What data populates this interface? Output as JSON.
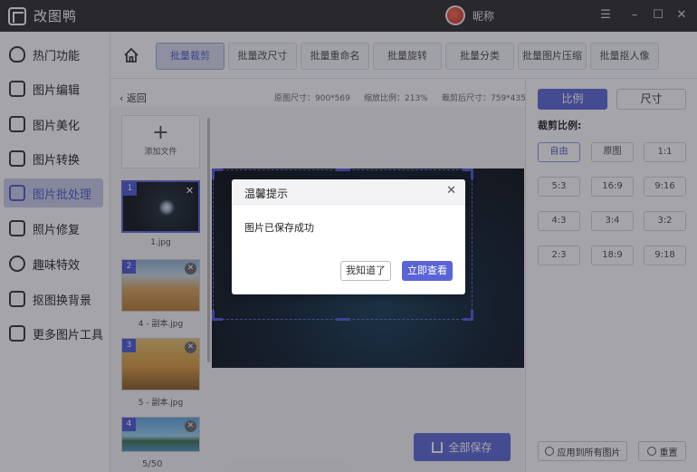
{
  "app": {
    "title": "改图鸭",
    "nickname": "昵称"
  },
  "window_controls": [
    "☰",
    "–",
    "☐",
    "✕"
  ],
  "sidebar": {
    "items": [
      {
        "label": "热门功能",
        "icon": "fire-icon"
      },
      {
        "label": "图片编辑",
        "icon": "image-edit-icon"
      },
      {
        "label": "图片美化",
        "icon": "beautify-icon"
      },
      {
        "label": "图片转换",
        "icon": "convert-icon"
      },
      {
        "label": "图片批处理",
        "icon": "batch-icon",
        "active": true
      },
      {
        "label": "照片修复",
        "icon": "repair-icon"
      },
      {
        "label": "趣味特效",
        "icon": "effects-icon"
      },
      {
        "label": "抠图换背景",
        "icon": "cutout-icon"
      },
      {
        "label": "更多图片工具",
        "icon": "toolbox-icon"
      }
    ]
  },
  "tabs": {
    "items": [
      "批量裁剪",
      "批量改尺寸",
      "批量重命名",
      "批量旋转",
      "批量分类",
      "批量图片压缩",
      "批量抠人像"
    ],
    "active_index": 0
  },
  "content": {
    "back_label": "返回",
    "original_size": "原图尺寸：900*569",
    "zoom_ratio": "缩放比例：213%",
    "cropped_size": "裁剪后尺寸：759*435"
  },
  "thumbnails": {
    "add_label": "添加文件",
    "items": [
      {
        "num": "1",
        "name": "1.jpg",
        "selected": true
      },
      {
        "num": "2",
        "name": "4 - 副本.jpg"
      },
      {
        "num": "3",
        "name": "5 - 副本.jpg"
      },
      {
        "num": "4",
        "name": ""
      }
    ],
    "page_count": "5/50"
  },
  "save_all_label": "全部保存",
  "right_panel": {
    "mode_tabs": [
      "比例",
      "尺寸"
    ],
    "crop_ratio_label": "裁剪比例:",
    "ratios": [
      "自由",
      "原图",
      "1:1",
      "5:3",
      "16:9",
      "9:16",
      "4:3",
      "3:4",
      "3:2",
      "2:3",
      "18:9",
      "9:18"
    ],
    "apply_all_label": "应用到所有图片",
    "reset_label": "重置"
  },
  "dialog": {
    "title": "温馨提示",
    "message": "图片已保存成功",
    "ok_label": "我知道了",
    "view_label": "立即查看"
  }
}
